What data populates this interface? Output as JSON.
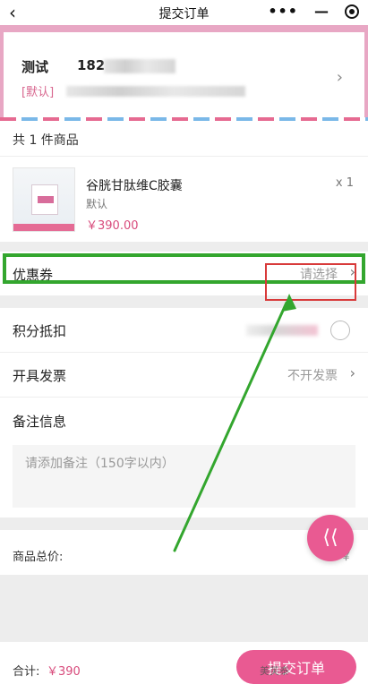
{
  "header": {
    "title": "提交订单",
    "back_icon": "‹",
    "more_icon": "•••",
    "minimize_icon": "—",
    "close_icon": "target-icon"
  },
  "address": {
    "name": "测试",
    "phone_visible": "182",
    "default_tag": "[默认]"
  },
  "items_count": "共 1 件商品",
  "product": {
    "name": "谷胱甘肽维C胶囊",
    "spec": "默认",
    "price": "￥390.00",
    "quantity": "x 1"
  },
  "coupon": {
    "label": "优惠券",
    "value": "请选择"
  },
  "points": {
    "label": "积分抵扣"
  },
  "invoice": {
    "label": "开具发票",
    "value": "不开发票"
  },
  "remark": {
    "label": "备注信息",
    "placeholder": "请添加备注（150字以内）"
  },
  "summary": {
    "label": "商品总价:",
    "amount": "￥"
  },
  "footer": {
    "total_label": "合计:",
    "total_value": "￥390",
    "submit_label": "提交订单",
    "watermark": "美芙泰"
  },
  "colors": {
    "accent": "#e95a92",
    "highlight_green": "#33a62e",
    "highlight_red": "#d83a3a"
  }
}
